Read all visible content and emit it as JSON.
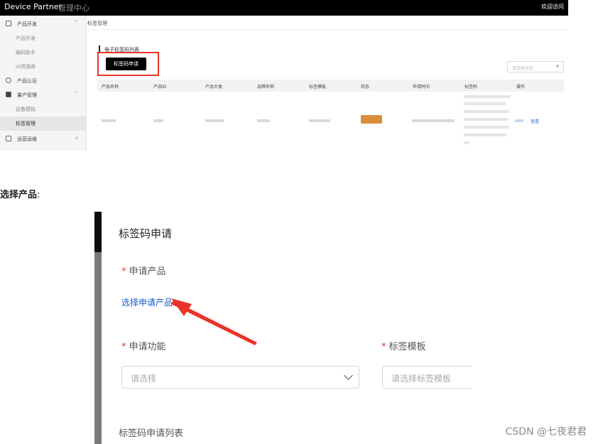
{
  "top_screenshot": {
    "brand": "Device Partner",
    "brand_sub": "管理中心",
    "welcome": "欢迎访问",
    "sidebar": {
      "items": [
        {
          "label": "产品开发",
          "icon": "grid-icon"
        },
        {
          "label": "产品开发",
          "sub": true
        },
        {
          "label": "编码助手",
          "sub": true
        },
        {
          "label": "UI资源库",
          "sub": true
        },
        {
          "label": "产品认证",
          "icon": "bulb-icon"
        },
        {
          "label": "量产管理",
          "icon": "cube-icon"
        },
        {
          "label": "设备模拟",
          "sub": true
        },
        {
          "label": "标签管理",
          "sub": true,
          "active": true
        },
        {
          "label": "运营运维",
          "icon": "monitor-icon"
        }
      ]
    },
    "breadcrumb": "标签管理",
    "section_title": "电子标签码列表",
    "apply_button": "标签码申请",
    "filter_placeholder": "请选择状态",
    "table_headers": [
      "产品名称",
      "产品ID",
      "产品大类",
      "品牌名称",
      "标签模板",
      "状态",
      "申请时间",
      "标签码",
      "操作"
    ],
    "op_link": "查看"
  },
  "caption": "选择产品",
  "caption_colon": ":",
  "dialog": {
    "title": "标签码申请",
    "apply_product_label": "申请产品",
    "select_product_link": "选择申请产品",
    "apply_function_label": "申请功能",
    "function_placeholder": "请选择",
    "label_template_label": "标签模板",
    "template_placeholder": "请选择标签模板",
    "list_title": "标签码申请列表",
    "required_mark": "*"
  },
  "colors": {
    "accent_red": "#e8342b",
    "link_blue": "#1559c9",
    "status_orange": "#d98f3a"
  },
  "watermark": "CSDN @七夜君君"
}
